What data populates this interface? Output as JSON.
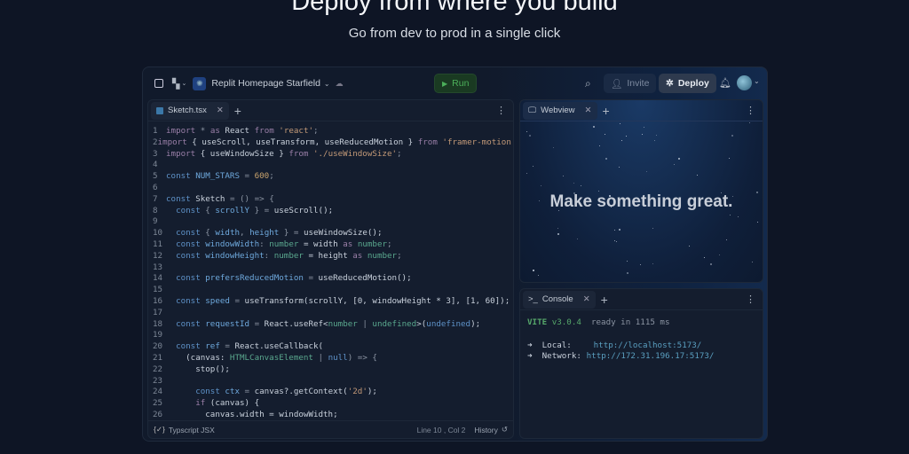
{
  "hero": {
    "title": "Deploy from where you build",
    "subtitle": "Go from dev to prod in a single click"
  },
  "topbar": {
    "project": "Replit Homepage Starfield",
    "run": "Run",
    "invite": "Invite",
    "deploy": "Deploy"
  },
  "editor": {
    "tab": "Sketch.tsx",
    "language": "Typscript JSX",
    "position": "Line 10 , Col 2",
    "history": "History",
    "lines": [
      [
        [
          "import",
          "kw"
        ],
        [
          " * ",
          "op"
        ],
        [
          "as",
          "kw"
        ],
        [
          " React ",
          "id"
        ],
        [
          "from",
          "kw"
        ],
        [
          " 'react'",
          "st"
        ],
        [
          ";",
          "op"
        ]
      ],
      [
        [
          "import",
          "kw"
        ],
        [
          " { useScroll, useTransform, useReducedMotion } ",
          "id"
        ],
        [
          "from",
          "kw"
        ],
        [
          " 'framer-motion'",
          "st"
        ],
        [
          ";",
          "op"
        ]
      ],
      [
        [
          "import",
          "kw"
        ],
        [
          " { useWindowSize } ",
          "id"
        ],
        [
          "from",
          "kw"
        ],
        [
          " './useWindowSize'",
          "st"
        ],
        [
          ";",
          "op"
        ]
      ],
      [],
      [
        [
          "const",
          "k2"
        ],
        [
          " NUM_STARS",
          "va"
        ],
        [
          " = ",
          "op"
        ],
        [
          "600",
          "nu"
        ],
        [
          ";",
          "op"
        ]
      ],
      [],
      [
        [
          "const",
          "k2"
        ],
        [
          " Sketch",
          "id"
        ],
        [
          " = () => {",
          "op"
        ]
      ],
      [
        [
          "  const",
          "k2"
        ],
        [
          " { ",
          "op"
        ],
        [
          "scrollY",
          "va"
        ],
        [
          " } = ",
          "op"
        ],
        [
          "useScroll();",
          "id"
        ]
      ],
      [],
      [
        [
          "  const",
          "k2"
        ],
        [
          " { ",
          "op"
        ],
        [
          "width",
          "va"
        ],
        [
          ", ",
          "op"
        ],
        [
          "height",
          "va"
        ],
        [
          " } = ",
          "op"
        ],
        [
          "useWindowSize();",
          "id"
        ]
      ],
      [
        [
          "  const",
          "k2"
        ],
        [
          " windowWidth",
          "va"
        ],
        [
          ": ",
          "op"
        ],
        [
          "number",
          "ty"
        ],
        [
          " = width ",
          "id"
        ],
        [
          "as",
          "kw"
        ],
        [
          " number",
          "ty"
        ],
        [
          ";",
          "op"
        ]
      ],
      [
        [
          "  const",
          "k2"
        ],
        [
          " windowHeight",
          "va"
        ],
        [
          ": ",
          "op"
        ],
        [
          "number",
          "ty"
        ],
        [
          " = height ",
          "id"
        ],
        [
          "as",
          "kw"
        ],
        [
          " number",
          "ty"
        ],
        [
          ";",
          "op"
        ]
      ],
      [],
      [
        [
          "  const",
          "k2"
        ],
        [
          " prefersReducedMotion",
          "va"
        ],
        [
          " = ",
          "op"
        ],
        [
          "useReducedMotion();",
          "id"
        ]
      ],
      [],
      [
        [
          "  const",
          "k2"
        ],
        [
          " speed",
          "va"
        ],
        [
          " = ",
          "op"
        ],
        [
          "useTransform(scrollY, [0, windowHeight * 3], [1, 60]);",
          "id"
        ]
      ],
      [],
      [
        [
          "  const",
          "k2"
        ],
        [
          " requestId",
          "va"
        ],
        [
          " = ",
          "op"
        ],
        [
          "React.useRef<",
          "id"
        ],
        [
          "number",
          "ty"
        ],
        [
          " | ",
          "op"
        ],
        [
          "undefined",
          "ty"
        ],
        [
          ">(",
          "id"
        ],
        [
          "undefined",
          "k2"
        ],
        [
          ");",
          "id"
        ]
      ],
      [],
      [
        [
          "  const",
          "k2"
        ],
        [
          " ref",
          "va"
        ],
        [
          " = ",
          "op"
        ],
        [
          "React.useCallback(",
          "id"
        ]
      ],
      [
        [
          "    (canvas: ",
          "id"
        ],
        [
          "HTMLCanvasElement",
          "ty"
        ],
        [
          " | ",
          "op"
        ],
        [
          "null",
          "k2"
        ],
        [
          ") => {",
          "op"
        ]
      ],
      [
        [
          "      stop();",
          "id"
        ]
      ],
      [],
      [
        [
          "      const",
          "k2"
        ],
        [
          " ctx",
          "va"
        ],
        [
          " = ",
          "op"
        ],
        [
          "canvas?.getContext(",
          "id"
        ],
        [
          "'2d'",
          "st"
        ],
        [
          ");",
          "id"
        ]
      ],
      [
        [
          "      if",
          "kw"
        ],
        [
          " (canvas) {",
          "id"
        ]
      ],
      [
        [
          "        canvas.width = windowWidth;",
          "id"
        ]
      ]
    ]
  },
  "webview": {
    "tab": "Webview",
    "headline": "Make something great."
  },
  "console": {
    "tab": "Console",
    "vite": "VITE",
    "version": "v3.0.4",
    "ready": "ready in 1115 ms",
    "local_label": "Local:",
    "local_url": "http://localhost:5173/",
    "network_label": "Network:",
    "network_url": "http://172.31.196.17:5173/",
    "arrow": "➜"
  }
}
